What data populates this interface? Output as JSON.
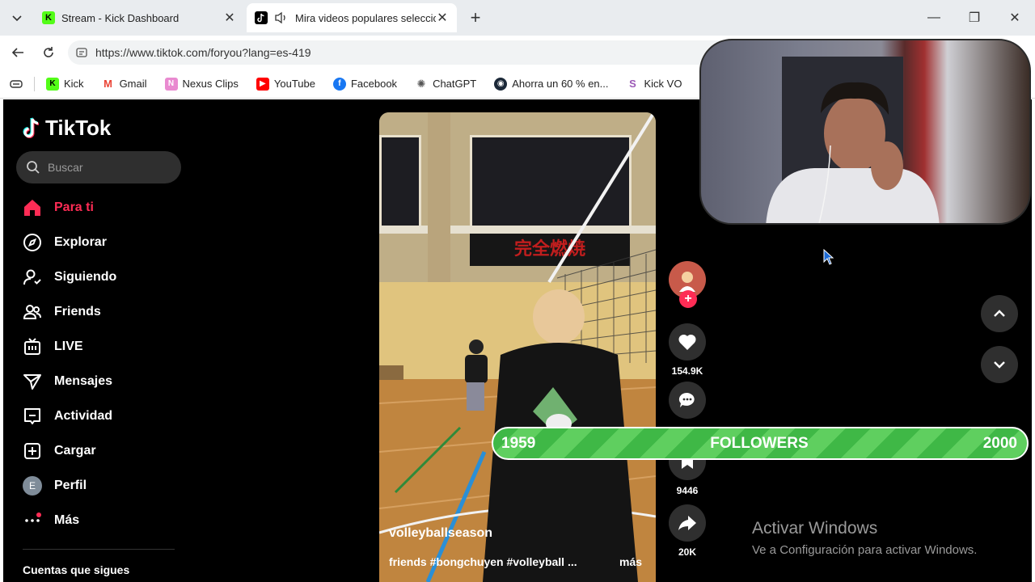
{
  "browser": {
    "tabs": [
      {
        "title": "Stream - Kick Dashboard",
        "favicon": "kick-icon",
        "color": "#53fc18"
      },
      {
        "title": "Mira videos populares selecciona",
        "favicon": "tiktok-icon",
        "muted_icon": "speaker-icon",
        "active": true
      }
    ],
    "url": "https://www.tiktok.com/foryou?lang=es-419",
    "bookmarks": [
      {
        "label": "Kick",
        "icon": "kick-icon",
        "color": "#53fc18"
      },
      {
        "label": "Gmail",
        "icon": "gmail-icon",
        "color": "#ea4335"
      },
      {
        "label": "Nexus Clips",
        "icon": "nexus-icon",
        "color": "#e98ad0"
      },
      {
        "label": "YouTube",
        "icon": "youtube-icon",
        "color": "#ff0000"
      },
      {
        "label": "Facebook",
        "icon": "facebook-icon",
        "color": "#1877f2"
      },
      {
        "label": "ChatGPT",
        "icon": "chatgpt-icon",
        "color": "#555555"
      },
      {
        "label": "Ahorra un 60 % en...",
        "icon": "steam-icon",
        "color": "#1b2838"
      },
      {
        "label": "Kick VO",
        "icon": "kickvo-icon",
        "color": "#9b59b6"
      }
    ]
  },
  "tiktok": {
    "logo": "TikTok",
    "search_placeholder": "Buscar",
    "nav": [
      {
        "label": "Para ti",
        "icon": "home-icon",
        "active": true
      },
      {
        "label": "Explorar",
        "icon": "compass-icon"
      },
      {
        "label": "Siguiendo",
        "icon": "following-icon"
      },
      {
        "label": "Friends",
        "icon": "friends-icon"
      },
      {
        "label": "LIVE",
        "icon": "live-icon"
      },
      {
        "label": "Mensajes",
        "icon": "messages-icon"
      },
      {
        "label": "Actividad",
        "icon": "activity-icon"
      },
      {
        "label": "Cargar",
        "icon": "upload-icon"
      },
      {
        "label": "Perfil",
        "icon": "profile-avatar",
        "avatar_letter": "E"
      },
      {
        "label": "Más",
        "icon": "more-icon"
      }
    ],
    "following_title": "Cuentas que sigues",
    "video": {
      "banner_text": "完全燃焼",
      "author": "volleyballseason",
      "description": "friends #bongchuyen #volleyball ...",
      "more": "más"
    },
    "actions": {
      "likes": "154.9K",
      "saves": "9446",
      "shares": "20K"
    }
  },
  "overlay": {
    "followers": {
      "current": "1959",
      "label": "FOLLOWERS",
      "goal": "2000",
      "progress": 0.9795
    },
    "activate_windows": {
      "title": "Activar Windows",
      "subtitle": "Ve a Configuración para activar Windows."
    }
  },
  "colors": {
    "tiktok_red": "#fe2c55",
    "follower_green": "#3fb846"
  }
}
